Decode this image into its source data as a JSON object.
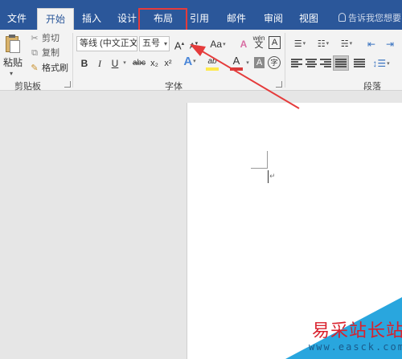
{
  "tabs": [
    "文件",
    "开始",
    "插入",
    "设计",
    "布局",
    "引用",
    "邮件",
    "审阅",
    "视图"
  ],
  "active_tab": "开始",
  "highlighted_tab": "布局",
  "tell_me": "告诉我您想要",
  "clipboard": {
    "paste": "粘贴",
    "cut": "剪切",
    "copy": "复制",
    "format_painter": "格式刷",
    "group_label": "剪贴板"
  },
  "font": {
    "font_name": "等线 (中文正文",
    "font_size": "五号",
    "grow": "A",
    "case": "Aa",
    "clear": "A",
    "phonetic": "wén",
    "phonetic_char": "文",
    "border_char": "A",
    "bold": "B",
    "italic": "I",
    "underline": "U",
    "strike": "abc",
    "subscript": "x₂",
    "superscript": "x²",
    "effects": "A",
    "highlight": "ab",
    "font_color": "A",
    "shade": "A",
    "enclose": "字",
    "group_label": "字体"
  },
  "paragraph": {
    "group_label": "段落"
  },
  "document": {
    "para_mark": "↵"
  },
  "watermark": {
    "cn": "易采站长站",
    "url": "www.easck.com"
  },
  "colors": {
    "title_bar": "#2b579a",
    "ribbon": "#f3f3f3",
    "annotation": "#e53b3b",
    "highlight_yellow": "#ffe94a",
    "font_red": "#d83b3b"
  }
}
